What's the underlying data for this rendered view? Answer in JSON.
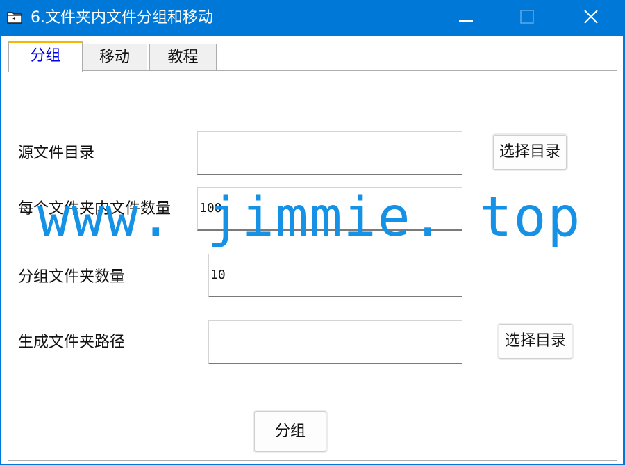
{
  "window": {
    "title": "6.文件夹内文件分组和移动"
  },
  "tabs": [
    {
      "label": "分组",
      "active": true
    },
    {
      "label": "移动",
      "active": false
    },
    {
      "label": "教程",
      "active": false
    }
  ],
  "form": {
    "source_dir_label": "源文件目录",
    "source_dir_value": "",
    "source_dir_button": "选择目录",
    "files_per_folder_label": "每个文件夹内文件数量",
    "files_per_folder_value": "100",
    "group_count_label": "分组文件夹数量",
    "group_count_value": "10",
    "output_dir_label": "生成文件夹路径",
    "output_dir_value": "",
    "output_dir_button": "选择目录",
    "group_button": "分组"
  },
  "watermark": "www. jimmie. top",
  "colors": {
    "titlebar": "#0078d7",
    "active_tab_text": "#0000ee",
    "active_tab_accent": "#f5b800",
    "watermark": "#1591e6"
  },
  "icons": {
    "app": "folder-icon",
    "minimize": "minimize-icon",
    "maximize": "maximize-icon",
    "close": "close-icon"
  }
}
